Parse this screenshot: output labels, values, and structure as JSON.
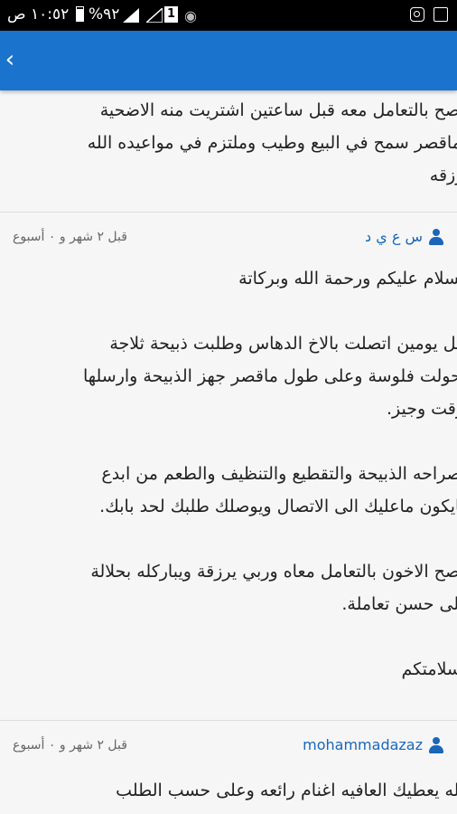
{
  "status_bar": {
    "time": "١٠:٥٢ ص",
    "battery_percent": "%٩٢",
    "sim_label": "1"
  },
  "post1": {
    "text": "انصح بالتعامل معه قبل ساعتين اشتريت منه الاضحية\nوماقصر سمح في البيع وطيب وملتزم في مواعيده الله\nيرزقه"
  },
  "comment1": {
    "username": "س ع ي د",
    "date": "قبل ٢ شهر و ٠ أسبوع",
    "text": "السلام عليكم ورحمة الله وبركاتة\n\nقبل يومين اتصلت بالاخ الدهاس وطلبت ذبيحة ثلاجة\nوحولت فلوسة وعلى طول ماقصر جهز الذبيحة وارسلها\nبوقت وجيز.\n\nوصراحه الذبيحة والتقطيع والتنظيف والطعم من ابدع\nمايكون ماعليك الى الاتصال ويوصلك طلبك لحد بابك.\n\nانصح الاخون بالتعامل معاه وربي يرزقة ويباركله بحلالة\nعلى حسن تعاملة.\n\nوسلامتكم"
  },
  "comment2": {
    "username": "mohammadazaz",
    "date": "قبل ٢ شهر و ٠ أسبوع",
    "text": "الله يعطيك العافيه اغنام رائعه وعلى حسب الطلب"
  },
  "icons": {
    "back": "chevron-left-icon",
    "user": "user-icon"
  },
  "colors": {
    "appbar": "#1a73cc",
    "username": "#1a67b8"
  }
}
